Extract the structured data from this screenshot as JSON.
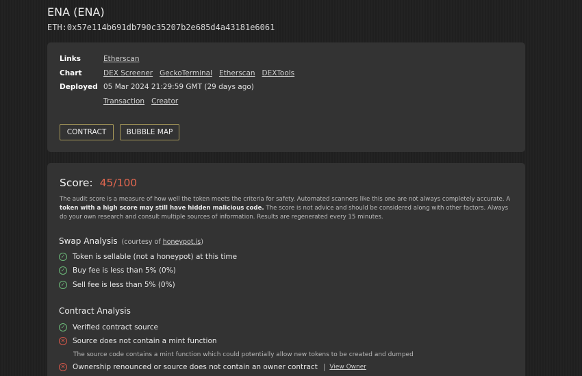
{
  "token": {
    "title": "ENA (ENA)",
    "address": "ETH:0x57e114b691db790c35207b2e685d4a43181e6061"
  },
  "info": {
    "links_label": "Links",
    "links": [
      "Etherscan"
    ],
    "chart_label": "Chart",
    "charts": [
      "DEX Screener",
      "GeckoTerminal",
      "Etherscan",
      "DEXTools"
    ],
    "deployed_label": "Deployed",
    "deployed_value": "05 Mar 2024 21:29:59 GMT (29 days ago)",
    "deploy_links": [
      "Transaction",
      "Creator"
    ]
  },
  "buttons": {
    "contract": "CONTRACT",
    "bubble_map": "BUBBLE MAP"
  },
  "score": {
    "label": "Score:",
    "value": "45/100",
    "desc_part1": "The audit score is a measure of how well the token meets the criteria for safety.  Automated scanners like this one are not always completely accurate.  A ",
    "desc_bold": "token with a high score may still have hidden malicious code.",
    "desc_part2": " The score is not advice and should be considered along with other factors. Always do your own research and consult multiple sources of information.  Results are regenerated every 15 minutes."
  },
  "swap_analysis": {
    "title": "Swap Analysis",
    "courtesy_prefix": "(courtesy of ",
    "courtesy_link": "honeypot.is",
    "courtesy_suffix": ")",
    "items": [
      {
        "text": "Token is sellable (not a honeypot) at this time",
        "status": "pass"
      },
      {
        "text": "Buy fee is less than 5% (0%)",
        "status": "pass"
      },
      {
        "text": "Sell fee is less than 5% (0%)",
        "status": "pass"
      }
    ]
  },
  "contract_analysis": {
    "title": "Contract Analysis",
    "items": [
      {
        "text": "Verified contract source",
        "status": "pass"
      },
      {
        "text": "Source does not contain a mint function",
        "status": "fail",
        "note": "The source code contains a mint function which could potentially allow new tokens to be created and dumped"
      },
      {
        "text": "Ownership renounced or source does not contain an owner contract",
        "status": "fail",
        "separator": "|",
        "link": "View Owner"
      }
    ]
  },
  "colors": {
    "score_accent": "#e0664f",
    "pass": "#6dbb7a",
    "fail": "#d9584a",
    "button_border": "#a89a5a",
    "panel": "#333333"
  },
  "icons": {
    "pass": "check-circle-icon",
    "fail": "x-circle-icon"
  }
}
